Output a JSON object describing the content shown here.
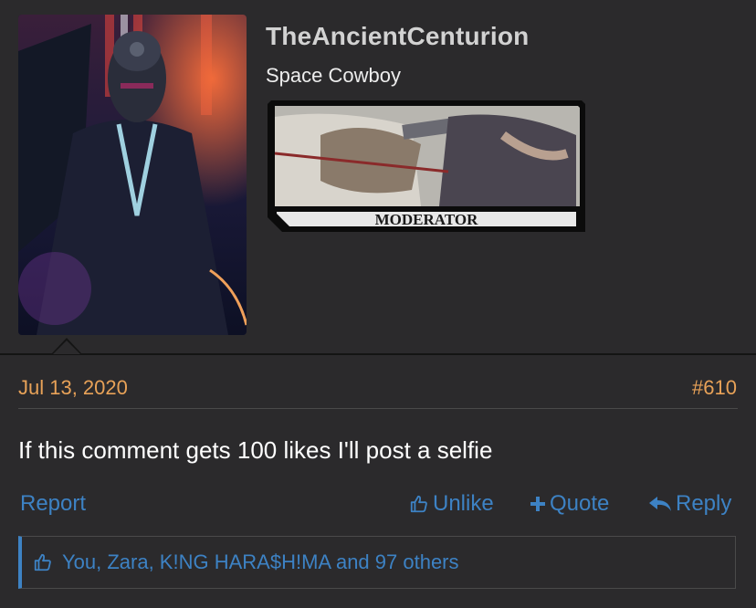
{
  "user": {
    "name": "TheAncientCenturion",
    "title": "Space Cowboy",
    "banner_label": "MODERATOR"
  },
  "post": {
    "date": "Jul 13, 2020",
    "number": "#610",
    "body": "If this comment gets 100 likes I'll post a selfie"
  },
  "actions": {
    "report": "Report",
    "unlike": "Unlike",
    "quote": "Quote",
    "reply": "Reply"
  },
  "likes": {
    "text": "You, Zara, K!NG HARA$H!MA and 97 others"
  },
  "colors": {
    "accent_link": "#3d82c4",
    "date_orange": "#e8a258",
    "background": "#2b2a2c"
  },
  "icons": {
    "unlike": "thumbs-up-outline-icon",
    "quote": "plus-icon",
    "reply": "reply-arrow-icon",
    "likes": "thumbs-up-outline-icon"
  }
}
